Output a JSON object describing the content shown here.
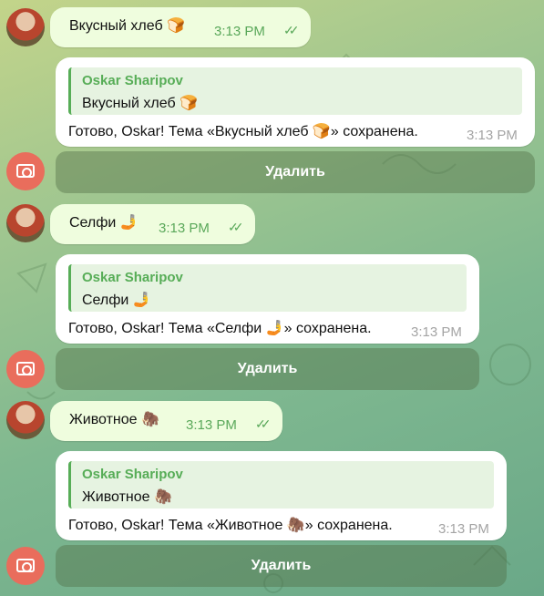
{
  "messages": [
    {
      "outgoing": {
        "text": "Вкусный хлеб 🍞",
        "time": "3:13 PM",
        "status": "✓✓"
      },
      "reply": {
        "quote_author": "Oskar Sharipov",
        "quote_text": "Вкусный хлеб 🍞",
        "text": "Готово, Oskar! Тема «Вкусный хлеб 🍞» сохранена.",
        "time": "3:13 PM"
      },
      "button": "Удалить"
    },
    {
      "outgoing": {
        "text": "Селфи 🤳",
        "time": "3:13 PM",
        "status": "✓✓"
      },
      "reply": {
        "quote_author": "Oskar Sharipov",
        "quote_text": "Селфи 🤳",
        "text": "Готово, Oskar! Тема «Селфи 🤳» сохранена.",
        "time": "3:13 PM"
      },
      "button": "Удалить"
    },
    {
      "outgoing": {
        "text": "Животное 🦣",
        "time": "3:13 PM",
        "status": "✓✓"
      },
      "reply": {
        "quote_author": "Oskar Sharipov",
        "quote_text": "Животное 🦣",
        "text": "Готово, Oskar! Тема «Животное 🦣» сохранена.",
        "time": "3:13 PM"
      },
      "button": "Удалить"
    }
  ],
  "colors": {
    "outgoing_bubble": "#effdde",
    "incoming_bubble": "#ffffff",
    "accent_green": "#57ad57",
    "bot_avatar": "#e96d5c"
  },
  "icons": {
    "user_avatar": "user-photo-avatar",
    "bot_avatar": "camera-icon"
  }
}
